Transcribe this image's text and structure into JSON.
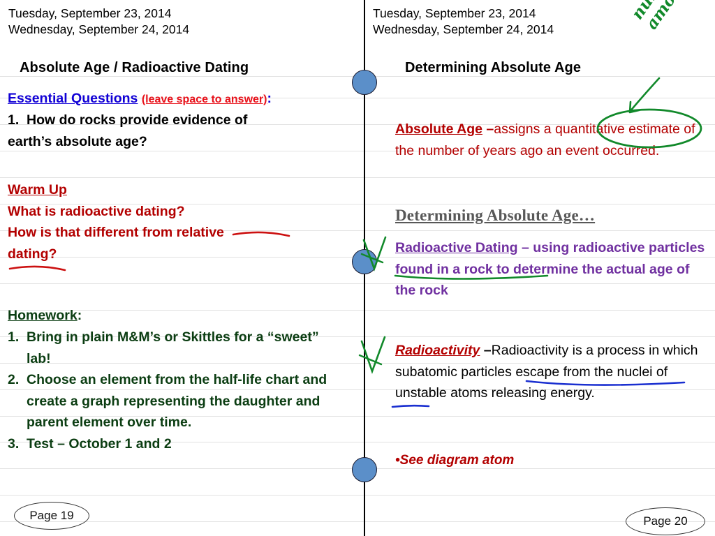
{
  "colors": {
    "blue_heading": "#1100d6",
    "red_text": "#b30000",
    "bright_red": "#e8111a",
    "dark_green": "#0b3d12",
    "purple": "#7030a0",
    "gray_serif": "#585858",
    "ink_green": "#11892a",
    "ink_blue": "#1a2fd0",
    "ink_red": "#cc1111",
    "bead_blue": "#5b8fc9"
  },
  "left": {
    "dates": "Tuesday, September 23, 2014\nWednesday, September 24, 2014",
    "title": "Absolute Age / Radioactive Dating",
    "essential": {
      "label": "Essential Questions",
      "note": "(leave space to answer)",
      "colon": ":",
      "question_number": "1.",
      "question_line1": "How do rocks provide evidence of",
      "question_line2": "earth’s absolute age?"
    },
    "warmup": {
      "label": "Warm Up",
      "line1": "What is radioactive dating?",
      "line2": "How is that different from relative",
      "line3": "dating?"
    },
    "homework": {
      "label": "Homework",
      "colon": ":",
      "items": [
        {
          "num": "1.",
          "text": "Bring in plain M&M’s or Skittles for a “sweet” lab!"
        },
        {
          "num": "2.",
          "text": "Choose an element from the half-life chart and create a graph representing the daughter and parent element over time."
        },
        {
          "num": "3.",
          "text": "Test – October 1 and 2"
        }
      ]
    },
    "page_label": "Page 19"
  },
  "right": {
    "dates": "Tuesday, September 23, 2014\nWednesday, September 24, 2014",
    "title": "Determining Absolute Age",
    "absolute_age": {
      "term": "Absolute Age",
      "dash": "–",
      "definition": "assigns a quantitative estimate of the number of years ago an event occurred."
    },
    "section_heading": "Determining Absolute Age…",
    "radioactive_dating": {
      "term": "Radioactive Dating",
      "dash": "–",
      "definition": "using radioactive particles found in a rock to determine the actual age of the rock"
    },
    "radioactivity": {
      "term": "Radioactivity",
      "dash": "–",
      "definition": "Radioactivity is a process in which subatomic particles escape from the nuclei of unstable atoms releasing energy."
    },
    "see_diagram": "•See diagram atom",
    "page_label": "Page 20"
  },
  "annotations": {
    "handwritten_note_line1": "numerical",
    "handwritten_note_line2": "amount",
    "circled_word": "quantitative",
    "green_underlined_phrase": "radioactive particles",
    "blue_underlined_phrase_1": "subatomic particles",
    "blue_underlined_phrase_2": "escape",
    "red_underlined_phrase_1": "relative",
    "red_underlined_phrase_2": "dating?",
    "checkmark_1": "green-check-radioactive-dating",
    "checkmark_2": "green-check-radioactivity"
  }
}
